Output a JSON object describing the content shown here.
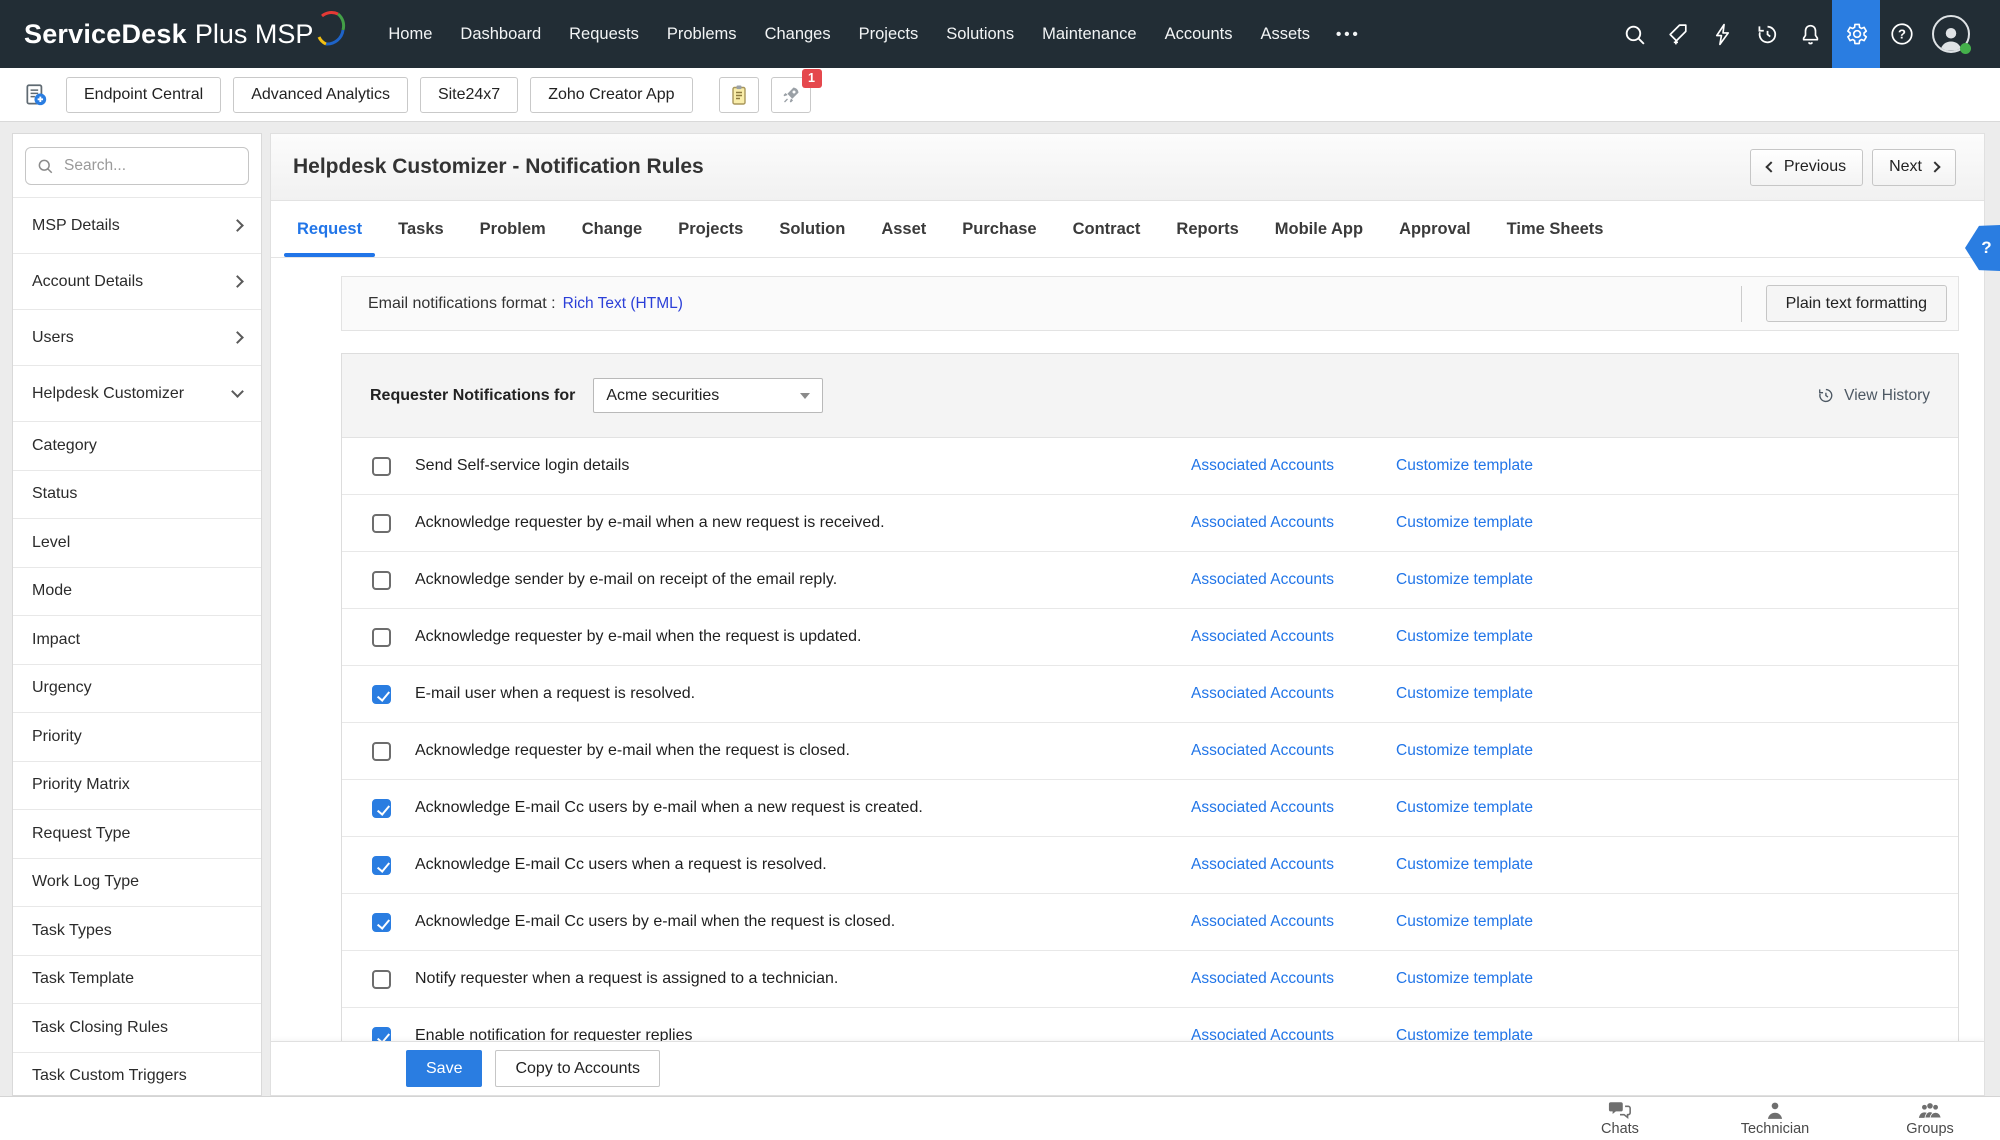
{
  "colors": {
    "topnav_bg": "#222d35",
    "accent_blue": "#2a7de1",
    "link_blue": "#2175e8",
    "format_link_blue": "#2b3fd8",
    "badge_red": "#e5484d"
  },
  "topnav": {
    "logo_bold": "ServiceDesk",
    "logo_rest": "Plus MSP",
    "items": [
      "Home",
      "Dashboard",
      "Requests",
      "Problems",
      "Changes",
      "Projects",
      "Solutions",
      "Maintenance",
      "Accounts",
      "Assets"
    ],
    "more": "•••",
    "active_icon": "gear-icon",
    "user_status": "online"
  },
  "toolbar": {
    "buttons": [
      "Endpoint Central",
      "Advanced Analytics",
      "Site24x7",
      "Zoho Creator App"
    ],
    "rocket_badge": "1"
  },
  "sidebar": {
    "search_placeholder": "Search...",
    "groups": [
      {
        "label": "MSP Details",
        "expanded": false
      },
      {
        "label": "Account Details",
        "expanded": false
      },
      {
        "label": "Users",
        "expanded": false
      },
      {
        "label": "Helpdesk Customizer",
        "expanded": true
      }
    ],
    "items": [
      "Category",
      "Status",
      "Level",
      "Mode",
      "Impact",
      "Urgency",
      "Priority",
      "Priority Matrix",
      "Request Type",
      "Work Log Type",
      "Task Types",
      "Task Template",
      "Task Closing Rules",
      "Task Custom Triggers"
    ]
  },
  "content": {
    "title": "Helpdesk Customizer - Notification Rules",
    "previous_label": "Previous",
    "next_label": "Next",
    "tabs": [
      "Request",
      "Tasks",
      "Problem",
      "Change",
      "Projects",
      "Solution",
      "Asset",
      "Purchase",
      "Contract",
      "Reports",
      "Mobile App",
      "Approval",
      "Time Sheets"
    ],
    "active_tab": "Request",
    "help_flag": "?",
    "email_format_label": "Email notifications format :",
    "email_format_value": "Rich Text (HTML)",
    "plain_text_button": "Plain text formatting",
    "panel": {
      "header_label": "Requester Notifications for",
      "account_selected": "Acme securities",
      "view_history_label": "View History",
      "links": {
        "associated": "Associated Accounts",
        "customize": "Customize template"
      },
      "rows": [
        {
          "text": "Send Self-service login details",
          "checked": false
        },
        {
          "text": "Acknowledge requester by e-mail when a new request is received.",
          "checked": false
        },
        {
          "text": "Acknowledge sender by e-mail on receipt of the email reply.",
          "checked": false
        },
        {
          "text": "Acknowledge requester by e-mail when the request is updated.",
          "checked": false
        },
        {
          "text": "E-mail user when a request is resolved.",
          "checked": true
        },
        {
          "text": "Acknowledge requester by e-mail when the request is closed.",
          "checked": false
        },
        {
          "text": "Acknowledge E-mail Cc users by e-mail when a new request is created.",
          "checked": true
        },
        {
          "text": "Acknowledge E-mail Cc users when a request is resolved.",
          "checked": true
        },
        {
          "text": "Acknowledge E-mail Cc users by e-mail when the request is closed.",
          "checked": true
        },
        {
          "text": "Notify requester when a request is assigned to a technician.",
          "checked": false
        },
        {
          "text": "Enable notification for requester replies",
          "checked": true
        }
      ]
    },
    "save_button": "Save",
    "copy_button": "Copy to Accounts"
  },
  "footer": {
    "items": [
      {
        "label": "Chats"
      },
      {
        "label": "Technician"
      },
      {
        "label": "Groups"
      }
    ]
  }
}
